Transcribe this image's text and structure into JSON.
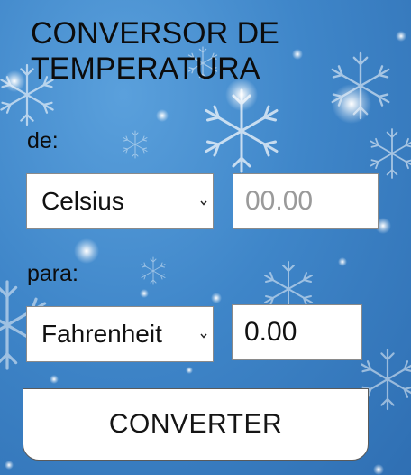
{
  "title": "CONVERSOR DE TEMPERATURA",
  "from": {
    "label": "de:",
    "unit": "Celsius",
    "placeholder": "00.00"
  },
  "to": {
    "label": "para:",
    "unit": "Fahrenheit",
    "value": "0.00"
  },
  "convert_button": "CONVERTER",
  "icons": {
    "dropdown": "chevron-down-icon",
    "background": "snowflake-pattern"
  },
  "colors": {
    "background": "#3f86c9",
    "text": "#0c0c0c",
    "field_bg": "#ffffff",
    "placeholder": "#9a9a9a"
  }
}
